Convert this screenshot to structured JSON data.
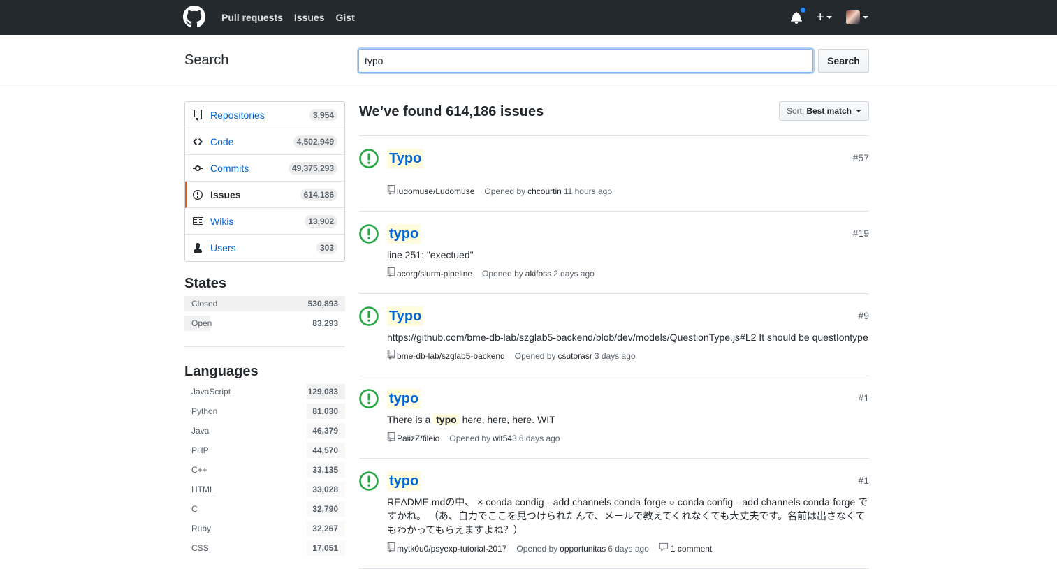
{
  "colors": {
    "header_bg": "#24292e",
    "link": "#0366d6",
    "open_green": "#28a745",
    "highlight": "#fffbdd",
    "selected_accent": "#e36209"
  },
  "header": {
    "nav": [
      "Pull requests",
      "Issues",
      "Gist"
    ],
    "notification_unread": true
  },
  "search": {
    "title": "Search",
    "query": "typo",
    "button": "Search"
  },
  "sidebar": {
    "types": [
      {
        "icon": "repo-icon",
        "label": "Repositories",
        "count": "3,954",
        "selected": false
      },
      {
        "icon": "code-icon",
        "label": "Code",
        "count": "4,502,949",
        "selected": false
      },
      {
        "icon": "commit-icon",
        "label": "Commits",
        "count": "49,375,293",
        "selected": false
      },
      {
        "icon": "issue-icon",
        "label": "Issues",
        "count": "614,186",
        "selected": true
      },
      {
        "icon": "book-icon",
        "label": "Wikis",
        "count": "13,902",
        "selected": false
      },
      {
        "icon": "person-icon",
        "label": "Users",
        "count": "303",
        "selected": false
      }
    ],
    "states_title": "States",
    "states": [
      {
        "label": "Closed",
        "count": "530,893",
        "share": 0.865
      },
      {
        "label": "Open",
        "count": "83,293",
        "share": 0.136
      }
    ],
    "languages_title": "Languages",
    "languages": [
      {
        "label": "JavaScript",
        "count": "129,083",
        "share": 0.23
      },
      {
        "label": "Python",
        "count": "81,030",
        "share": 0.14
      },
      {
        "label": "Java",
        "count": "46,379",
        "share": 0.08
      },
      {
        "label": "PHP",
        "count": "44,570",
        "share": 0.08
      },
      {
        "label": "C++",
        "count": "33,135",
        "share": 0.06
      },
      {
        "label": "HTML",
        "count": "33,028",
        "share": 0.06
      },
      {
        "label": "C",
        "count": "32,790",
        "share": 0.06
      },
      {
        "label": "Ruby",
        "count": "32,267",
        "share": 0.06
      },
      {
        "label": "CSS",
        "count": "17,051",
        "share": 0.03
      }
    ]
  },
  "results": {
    "heading": "We’ve found 614,186 issues",
    "sort_label": "Sort:",
    "sort_value": "Best match",
    "issues": [
      {
        "title": "Typo",
        "number": "#57",
        "body_pre": "",
        "body_mark": "",
        "body_post": "",
        "repo": "ludomuse/Ludomuse",
        "opened_by": "Opened by",
        "user": "chcourtin",
        "time": "11 hours ago",
        "comments": ""
      },
      {
        "title": "typo",
        "number": "#19",
        "body_pre": "line 251: \"exectued\"",
        "body_mark": "",
        "body_post": "",
        "repo": "acorg/slurm-pipeline",
        "opened_by": "Opened by",
        "user": "akifoss",
        "time": "2 days ago",
        "comments": ""
      },
      {
        "title": "Typo",
        "number": "#9",
        "body_pre": "https://github.com/bme-db-lab/szglab5-backend/blob/dev/models/QuestionType.js#L2 It should be questIontype",
        "body_mark": "",
        "body_post": "",
        "repo": "bme-db-lab/szglab5-backend",
        "opened_by": "Opened by",
        "user": "csutorasr",
        "time": "3 days ago",
        "comments": ""
      },
      {
        "title": "typo",
        "number": "#1",
        "body_pre": "There is a ",
        "body_mark": "typo",
        "body_post": " here, here, here. WIT",
        "repo": "PaiizZ/fileio",
        "opened_by": "Opened by",
        "user": "wit543",
        "time": "6 days ago",
        "comments": ""
      },
      {
        "title": "typo",
        "number": "#1",
        "body_pre": "README.mdの中、 × conda condig --add channels conda-forge ○ conda config --add channels conda-forge ですかね。 （あ、自力でここを見つけられたんで、メールで教えてくれなくても大丈夫です。名前は出さなくてもわかってもらえますよね？）",
        "body_mark": "",
        "body_post": "",
        "repo": "mytk0u0/psyexp-tutorial-2017",
        "opened_by": "Opened by",
        "user": "opportunitas",
        "time": "6 days ago",
        "comments": "1 comment"
      }
    ]
  }
}
